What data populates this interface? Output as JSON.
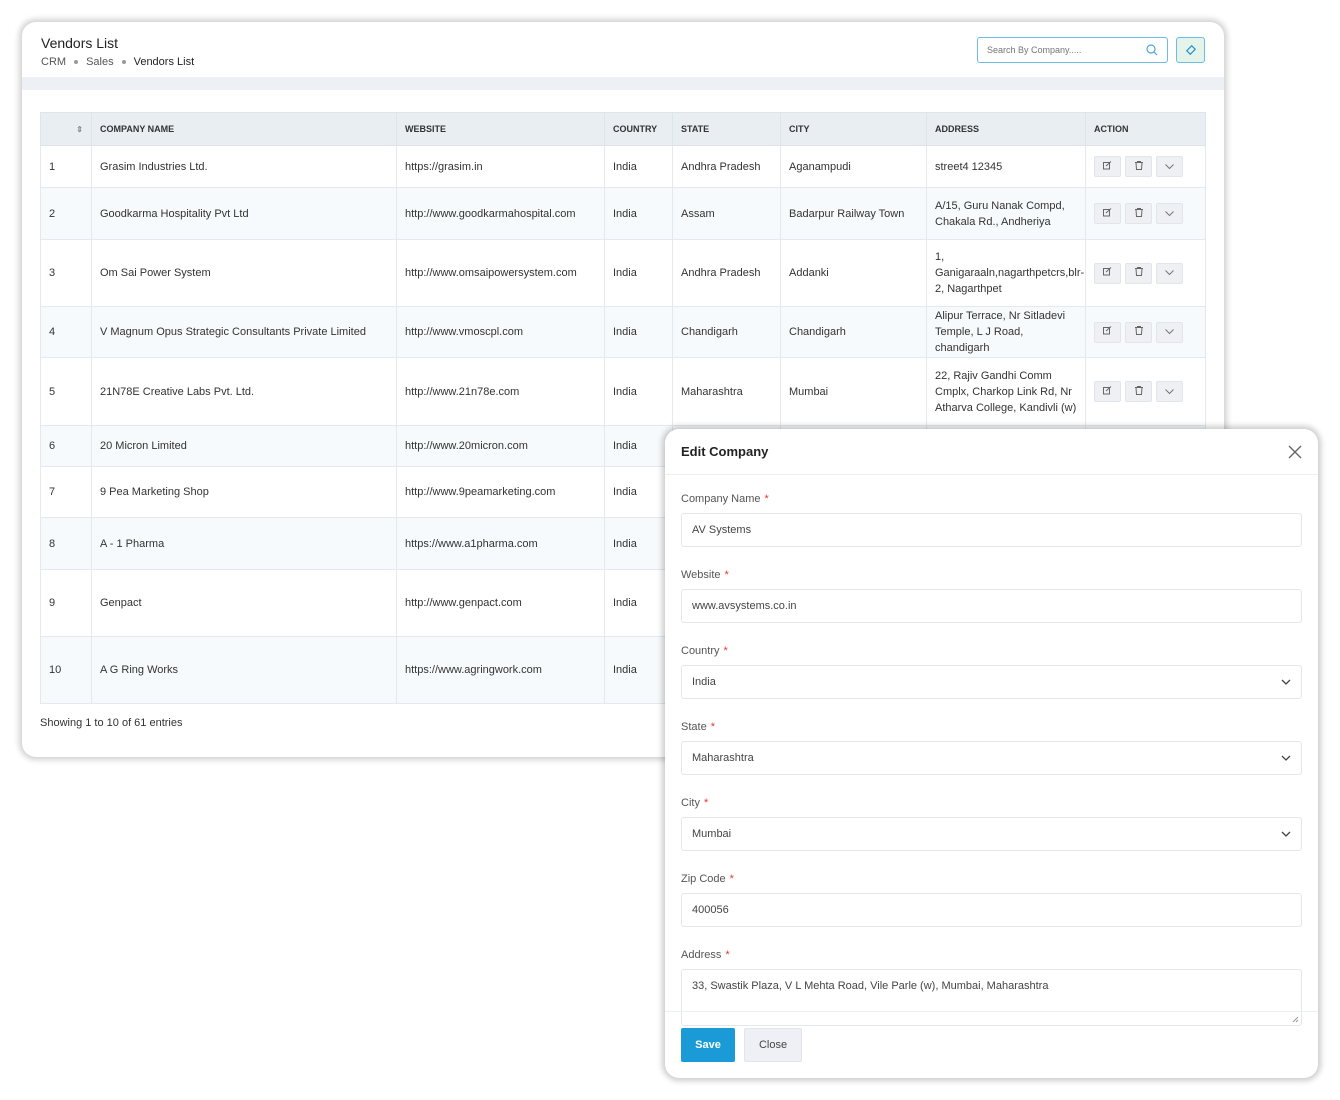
{
  "page": {
    "title": "Vendors List",
    "breadcrumb": [
      "CRM",
      "Sales",
      "Vendors List"
    ]
  },
  "search": {
    "placeholder": "Search By Company.....",
    "icon": "search-icon"
  },
  "table": {
    "columns": [
      "",
      "COMPANY NAME",
      "WEBSITE",
      "COUNTRY",
      "STATE",
      "CITY",
      "ADDRESS",
      "ACTION"
    ],
    "rows": [
      {
        "no": "1",
        "company": "Grasim Industries Ltd.",
        "website": "https://grasim.in",
        "country": "India",
        "state": "Andhra Pradesh",
        "city": "Aganampudi",
        "address": "street4 12345"
      },
      {
        "no": "2",
        "company": "Goodkarma Hospitality Pvt Ltd",
        "website": "http://www.goodkarmahospital.com",
        "country": "India",
        "state": "Assam",
        "city": "Badarpur Railway Town",
        "address": "A/15, Guru Nanak Compd, Chakala Rd., Andheriya"
      },
      {
        "no": "3",
        "company": "Om Sai Power System",
        "website": "http://www.omsaipowersystem.com",
        "country": "India",
        "state": "Andhra Pradesh",
        "city": "Addanki",
        "address": "1, Ganigaraaln,nagarthpetcrs,blr-2, Nagarthpet"
      },
      {
        "no": "4",
        "company": "V Magnum Opus Strategic Consultants Private Limited",
        "website": "http://www.vmoscpl.com",
        "country": "India",
        "state": "Chandigarh",
        "city": "Chandigarh",
        "address": "Alipur Terrace, Nr Sitladevi Temple, L J Road, chandigarh"
      },
      {
        "no": "5",
        "company": "21N78E Creative Labs Pvt. Ltd.",
        "website": "http://www.21n78e.com",
        "country": "India",
        "state": "Maharashtra",
        "city": "Mumbai",
        "address": "22, Rajiv Gandhi Comm Cmplx, Charkop Link Rd, Nr Atharva College, Kandivli (w)"
      },
      {
        "no": "6",
        "company": "20 Micron Limited",
        "website": "http://www.20micron.com",
        "country": "India"
      },
      {
        "no": "7",
        "company": "9 Pea Marketing Shop",
        "website": "http://www.9peamarketing.com",
        "country": "India"
      },
      {
        "no": "8",
        "company": "A - 1 Pharma",
        "website": "https://www.a1pharma.com",
        "country": "India"
      },
      {
        "no": "9",
        "company": "Genpact",
        "website": "http://www.genpact.com",
        "country": "India"
      },
      {
        "no": "10",
        "company": "A G Ring Works",
        "website": "https://www.agringwork.com",
        "country": "India"
      }
    ],
    "footer": "Showing 1 to 10 of 61 entries"
  },
  "modal": {
    "title": "Edit Company",
    "fields": [
      {
        "label": "Company Name",
        "value": "AV Systems",
        "type": "text"
      },
      {
        "label": "Website",
        "value": "www.avsystems.co.in",
        "type": "text"
      },
      {
        "label": "Country",
        "value": "India",
        "type": "select"
      },
      {
        "label": "State",
        "value": "Maharashtra",
        "type": "select"
      },
      {
        "label": "City",
        "value": "Mumbai",
        "type": "select"
      },
      {
        "label": "Zip Code",
        "value": "400056",
        "type": "text"
      },
      {
        "label": "Address",
        "value": "33, Swastik Plaza, V L Mehta Road, Vile Parle (w), Mumbai, Maharashtra",
        "type": "textarea"
      }
    ],
    "required_mark": "*",
    "save_label": "Save",
    "close_label": "Close"
  },
  "colors": {
    "accent": "#1a9ad6",
    "required": "#ee3333"
  }
}
